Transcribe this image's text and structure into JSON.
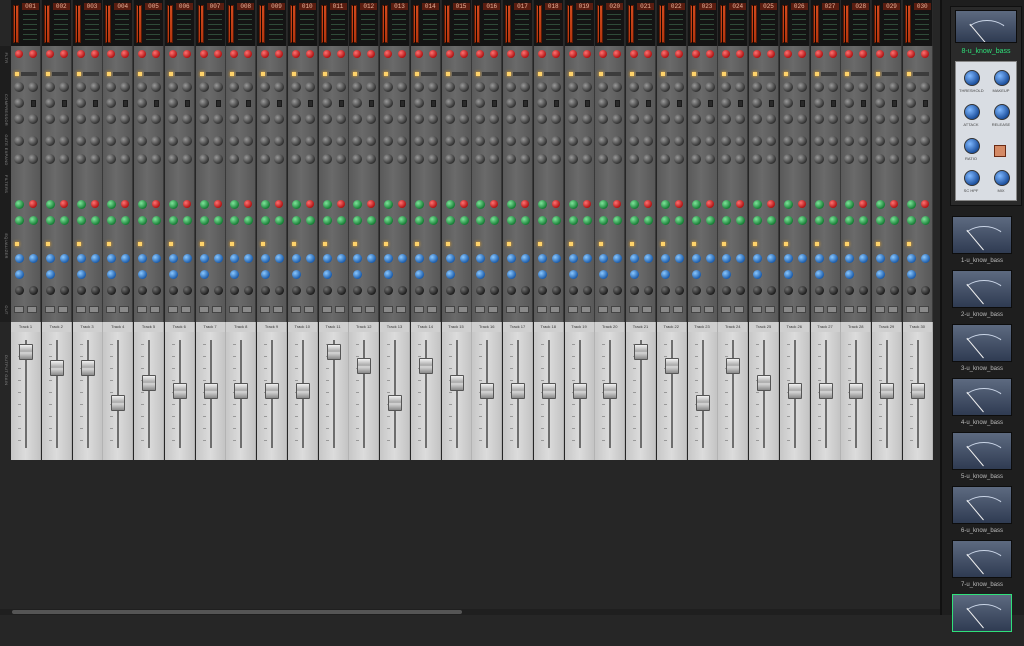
{
  "section_labels": [
    "FLTR",
    "COMPRESSOR",
    "GATE EXPAND",
    "FILTERS",
    "EQUALIZER",
    "OUT",
    "OUTPUT GAIN"
  ],
  "channels": [
    {
      "num": "001",
      "track": "Track 1",
      "level": 0.96
    },
    {
      "num": "002",
      "track": "Track 2",
      "level": 0.78
    },
    {
      "num": "003",
      "track": "Track 3",
      "level": 0.78
    },
    {
      "num": "004",
      "track": "Track 4",
      "level": 0.4
    },
    {
      "num": "005",
      "track": "Track 5",
      "level": 0.62
    },
    {
      "num": "006",
      "track": "Track 6",
      "level": 0.53
    },
    {
      "num": "007",
      "track": "Track 7",
      "level": 0.53
    },
    {
      "num": "008",
      "track": "Track 8",
      "level": 0.53
    },
    {
      "num": "009",
      "track": "Track 9",
      "level": 0.53
    },
    {
      "num": "010",
      "track": "Track 10",
      "level": 0.53
    },
    {
      "num": "011",
      "track": "Track 11",
      "level": 0.96
    },
    {
      "num": "012",
      "track": "Track 12",
      "level": 0.8
    },
    {
      "num": "013",
      "track": "Track 13",
      "level": 0.4
    },
    {
      "num": "014",
      "track": "Track 14",
      "level": 0.8
    },
    {
      "num": "015",
      "track": "Track 15",
      "level": 0.62
    },
    {
      "num": "016",
      "track": "Track 16",
      "level": 0.53
    },
    {
      "num": "017",
      "track": "Track 17",
      "level": 0.53
    },
    {
      "num": "018",
      "track": "Track 18",
      "level": 0.53
    },
    {
      "num": "019",
      "track": "Track 19",
      "level": 0.53
    },
    {
      "num": "020",
      "track": "Track 20",
      "level": 0.53
    },
    {
      "num": "021",
      "track": "Track 21",
      "level": 0.96
    },
    {
      "num": "022",
      "track": "Track 22",
      "level": 0.8
    },
    {
      "num": "023",
      "track": "Track 23",
      "level": 0.4
    },
    {
      "num": "024",
      "track": "Track 24",
      "level": 0.8
    },
    {
      "num": "025",
      "track": "Track 25",
      "level": 0.62
    },
    {
      "num": "026",
      "track": "Track 26",
      "level": 0.53
    },
    {
      "num": "027",
      "track": "Track 27",
      "level": 0.53
    },
    {
      "num": "028",
      "track": "Track 28",
      "level": 0.53
    },
    {
      "num": "029",
      "track": "Track 29",
      "level": 0.53
    },
    {
      "num": "030",
      "track": "Track 30",
      "level": 0.53
    }
  ],
  "compressor": {
    "name": "8-u_know_bass",
    "labels": {
      "threshold": "THRESHOLD",
      "makeup": "MAKEUP",
      "attack": "ATTACK",
      "release": "RELEASE",
      "ratio": "RATIO",
      "sc_hpf": "SC HPF",
      "mix": "MIX"
    }
  },
  "presets": [
    "1-u_know_bass",
    "2-u_know_bass",
    "3-u_know_bass",
    "4-u_know_bass",
    "5-u_know_bass",
    "6-u_know_bass",
    "7-u_know_bass",
    ""
  ],
  "colors": {
    "accent_green": "#2fe07a",
    "meter_red": "#d14a1e"
  }
}
